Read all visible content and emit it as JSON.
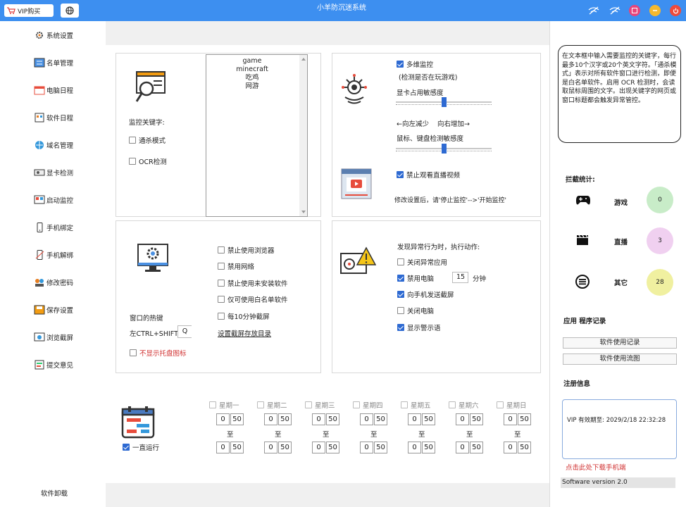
{
  "titlebar": {
    "vip": "VIP购买",
    "title": "小羊防沉迷系统"
  },
  "sidebar": {
    "items": [
      "系统设置",
      "名单管理",
      "电脑日程",
      "软件日程",
      "域名管理",
      "显卡检测",
      "启动监控",
      "手机绑定",
      "手机解绑",
      "修改密码",
      "保存设置",
      "浏览截屏",
      "提交意见"
    ],
    "uninstall": "软件卸载"
  },
  "keywords": {
    "list": [
      "game",
      "minecraft",
      "吃鸡",
      "网游"
    ],
    "label": "监控关键字:",
    "kill_mode": "通杀模式",
    "ocr": "OCR检测"
  },
  "multi": {
    "label": "多维监控",
    "desc": "(检测是否在玩游戏)",
    "gpu": "显卡占用敏感度",
    "gpu_level": 0.5,
    "hint_left": "←向左减少",
    "hint_right": "向右增加→",
    "kb": "鼠标、键盘检测敏感度",
    "kb_level": 0.5,
    "live": "禁止观看直播视频",
    "notice": "修改设置后，请'停止监控'-->'开始监控'"
  },
  "window": {
    "hotkey_label": "窗口的热键",
    "hotkey_prefix": "左CTRL+SHIFT+",
    "hotkey_key": "Q",
    "hide_tray": "不显示托盘图标",
    "options": [
      "禁止使用浏览器",
      "禁用网络",
      "禁止使用未安装软件",
      "仅可使用白名单软件",
      "每10分钟截屏"
    ],
    "screenshot_dir": "设置截屏存放目录"
  },
  "action": {
    "title": "发现异常行为时，执行动作:",
    "close_app": "关闭异常应用",
    "disable_pc": "禁用电脑",
    "minutes": "15",
    "minutes_unit": "分钟",
    "send_shot": "向手机发送截屏",
    "shutdown": "关闭电脑",
    "warn": "显示警示语"
  },
  "schedule": {
    "always": "一直运行",
    "days": [
      "星期一",
      "星期二",
      "星期三",
      "星期四",
      "星期五",
      "星期六",
      "星期日"
    ],
    "start": [
      "0",
      "50"
    ],
    "end": [
      "0",
      "50"
    ],
    "to": "至"
  },
  "right": {
    "help": "在文本框中输入需要监控的关键字，每行最多10个汉字或20个英文字符。「通杀模式」表示对所有软件窗口进行检测，即便是白名单软件。启用 OCR 检测时，会读取鼠标周围的文字。出现关键字的网页或窗口标题都会触发异常管控。",
    "stats_title": "拦截统计:",
    "game": "游戏",
    "game_count": "0",
    "live": "直播",
    "live_count": "3",
    "other": "其它",
    "other_count": "28",
    "records_title": "应用 程序记录",
    "btn_log": "软件使用记录",
    "btn_chart": "软件使用流图",
    "reg_title": "注册信息",
    "vip_expire": "VIP 有效期至: 2029/2/18 22:32:28",
    "download": "点击此处下载手机端",
    "version": "Software version 2.0"
  },
  "colors": {
    "accent": "#3d8ff0",
    "check": "#2e6ad2",
    "red": "#d03030",
    "green": "#c8ecc8",
    "pink": "#f0d0f0",
    "yellow": "#f0f0a0"
  }
}
